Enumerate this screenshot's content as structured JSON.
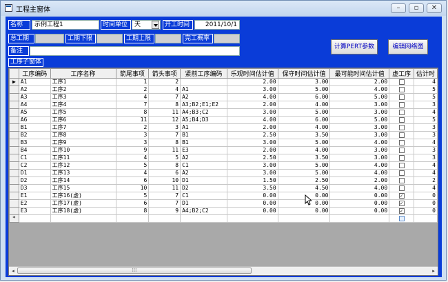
{
  "window": {
    "title": "工程主窗体"
  },
  "header": {
    "name_label": "名称",
    "name_value": "示例工程1",
    "unit_label": "时间单位",
    "unit_value": "天",
    "start_label": "开工时间",
    "start_value": "2011/10/1",
    "total_label": "总工期",
    "lower_label": "工期下限",
    "upper_label": "工期上限",
    "prob_label": "完工概率",
    "note_label": "备注",
    "calc_button": "计算PERT参数",
    "edit_button": "编辑网络图"
  },
  "subform": {
    "label": "工序子窗体"
  },
  "grid": {
    "columns": [
      "工序编码",
      "工序名称",
      "箭尾事项",
      "箭头事项",
      "紧前工序编码",
      "乐观时间估计值",
      "保守时间估计值",
      "最可能时间估计值",
      "虚工序",
      "估计时"
    ],
    "rows": [
      [
        "A1",
        "工序1",
        "1",
        "2",
        "",
        "2.00",
        "3.00",
        "2.00",
        false,
        "4"
      ],
      [
        "A2",
        "工序2",
        "2",
        "4",
        "A1",
        "3.00",
        "5.00",
        "4.00",
        false,
        "5"
      ],
      [
        "A3",
        "工序3",
        "4",
        "7",
        "A2",
        "4.00",
        "6.00",
        "5.00",
        false,
        "5"
      ],
      [
        "A4",
        "工序4",
        "7",
        "8",
        "A3;B2;E1;E2",
        "2.00",
        "4.00",
        "3.00",
        false,
        "3"
      ],
      [
        "A5",
        "工序5",
        "8",
        "11",
        "A4;B3;C2",
        "3.00",
        "5.00",
        "3.00",
        false,
        "4"
      ],
      [
        "A6",
        "工序6",
        "11",
        "12",
        "A5;B4;D3",
        "4.00",
        "6.00",
        "5.00",
        false,
        "5"
      ],
      [
        "B1",
        "工序7",
        "2",
        "3",
        "A1",
        "2.00",
        "4.00",
        "3.00",
        false,
        "3"
      ],
      [
        "B2",
        "工序8",
        "3",
        "7",
        "B1",
        "2.50",
        "3.50",
        "3.00",
        false,
        "3"
      ],
      [
        "B3",
        "工序9",
        "3",
        "8",
        "B1",
        "3.00",
        "5.00",
        "4.00",
        false,
        "4"
      ],
      [
        "B4",
        "工序10",
        "9",
        "11",
        "E3",
        "2.00",
        "4.00",
        "3.00",
        false,
        "3"
      ],
      [
        "C1",
        "工序11",
        "4",
        "5",
        "A2",
        "2.50",
        "3.50",
        "3.00",
        false,
        "3"
      ],
      [
        "C2",
        "工序12",
        "5",
        "8",
        "C1",
        "3.00",
        "5.00",
        "4.00",
        false,
        "4"
      ],
      [
        "D1",
        "工序13",
        "4",
        "6",
        "A2",
        "3.00",
        "5.00",
        "4.00",
        false,
        "4"
      ],
      [
        "D2",
        "工序14",
        "6",
        "10",
        "D1",
        "1.50",
        "2.50",
        "2.00",
        false,
        "2"
      ],
      [
        "D3",
        "工序15",
        "10",
        "11",
        "D2",
        "3.50",
        "4.50",
        "4.00",
        false,
        "4"
      ],
      [
        "E1",
        "工序16(虚)",
        "5",
        "7",
        "C1",
        "0.00",
        "0.00",
        "0.00",
        true,
        "0"
      ],
      [
        "E2",
        "工序17(虚)",
        "6",
        "7",
        "D1",
        "0.00",
        "0.00",
        "0.00",
        true,
        "0"
      ],
      [
        "E3",
        "工序18(虚)",
        "8",
        "9",
        "A4;B2;C2",
        "0.00",
        "0.00",
        "0.00",
        true,
        "0"
      ]
    ],
    "current_row_marker": "▶",
    "new_row_marker": "*"
  },
  "scrollbar": {
    "left_arrow": "◂",
    "right_arrow": "▸",
    "thumb_grip": "⁞⁞⁞"
  },
  "icons": {
    "window_icon": "form-icon",
    "minimize": "minimize-icon",
    "restore": "restore-icon",
    "close": "close-icon"
  }
}
